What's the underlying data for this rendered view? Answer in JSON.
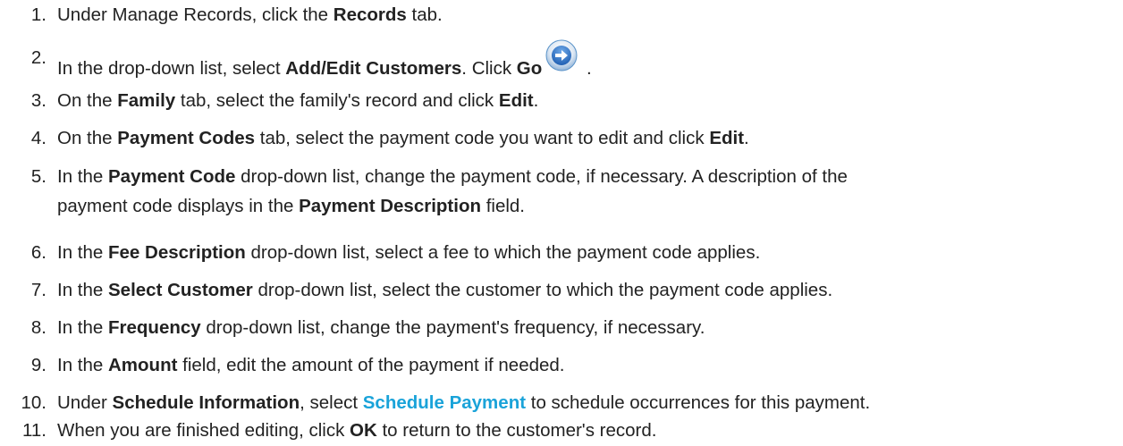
{
  "steps": [
    {
      "num": "1.",
      "pre": "Under Manage Records, click the ",
      "bold": "Records",
      "post": " tab."
    },
    {
      "num": "2.",
      "pre": "In the drop-down list, select ",
      "bold": "Add/Edit Customers",
      "mid": ". Click ",
      "bold2": "Go",
      "post": " .",
      "icon": "go-arrow-icon"
    },
    {
      "num": "3.",
      "pre": "On the ",
      "bold": "Family",
      "mid": " tab, select the family's record and click ",
      "bold2": "Edit",
      "post": "."
    },
    {
      "num": "4.",
      "pre": "On the ",
      "bold": "Payment Codes",
      "mid": " tab, select the payment code you want to edit and click ",
      "bold2": "Edit",
      "post": "."
    },
    {
      "num": "5.",
      "pre": "In the ",
      "bold": "Payment Code",
      "mid": " drop-down list, change the payment code, if necessary. A description of the",
      "line2_pre": "payment code displays in the ",
      "bold2": "Payment Description",
      "post": " field."
    },
    {
      "num": "6.",
      "pre": "In the ",
      "bold": "Fee Description",
      "post": " drop-down list, select a fee to which the payment code applies."
    },
    {
      "num": "7.",
      "pre": "In the ",
      "bold": "Select Customer",
      "post": " drop-down list, select the customer to which the payment code applies."
    },
    {
      "num": "8.",
      "pre": "In the ",
      "bold": "Frequency",
      "post": " drop-down list, change the payment's frequency, if necessary."
    },
    {
      "num": "9.",
      "pre": "In the ",
      "bold": "Amount",
      "post": " field, edit the amount of the payment if needed."
    },
    {
      "num": "10.",
      "pre": "Under ",
      "bold": "Schedule Information",
      "mid": ", select ",
      "link": "Schedule Payment",
      "post": " to schedule occurrences for this payment."
    },
    {
      "num": "11.",
      "pre": "When you are finished editing, click ",
      "bold": "OK",
      "post": " to return to the customer's record."
    }
  ],
  "colors": {
    "text": "#222222",
    "link": "#1aa3d9",
    "icon_ring": "#5a93c9",
    "icon_fill": "#2a6fc4"
  }
}
